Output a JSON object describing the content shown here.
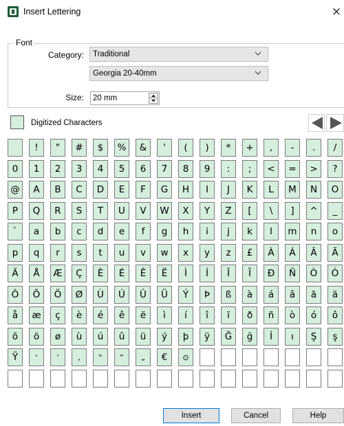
{
  "window": {
    "title": "Insert Lettering",
    "close_glyph": "×"
  },
  "font_group": {
    "legend": "Font",
    "category_label": "Category:",
    "category_value": "Traditional",
    "font_value": "Georgia 20-40mm",
    "size_label": "Size:",
    "size_value": "20 mm"
  },
  "digitized": {
    "label": "Digitized Characters",
    "checked": false
  },
  "character_grid": {
    "columns": 16,
    "rows": [
      [
        "",
        "!",
        "\"",
        "#",
        "$",
        "%",
        "&",
        "'",
        "(",
        ")",
        "*",
        "+",
        ",",
        "-",
        ".",
        "/"
      ],
      [
        "0",
        "1",
        "2",
        "3",
        "4",
        "5",
        "6",
        "7",
        "8",
        "9",
        ":",
        ";",
        "<",
        "=",
        ">",
        "?"
      ],
      [
        "@",
        "A",
        "B",
        "C",
        "D",
        "E",
        "F",
        "G",
        "H",
        "I",
        "J",
        "K",
        "L",
        "M",
        "N",
        "O"
      ],
      [
        "P",
        "Q",
        "R",
        "S",
        "T",
        "U",
        "V",
        "W",
        "X",
        "Y",
        "Z",
        "[",
        "\\",
        "]",
        "^",
        "_"
      ],
      [
        "`",
        "a",
        "b",
        "c",
        "d",
        "e",
        "f",
        "g",
        "h",
        "i",
        "j",
        "k",
        "l",
        "m",
        "n",
        "o"
      ],
      [
        "p",
        "q",
        "r",
        "s",
        "t",
        "u",
        "v",
        "w",
        "x",
        "y",
        "z",
        "£",
        "À",
        "Á",
        "Â",
        "Ã"
      ],
      [
        "Ä",
        "Å",
        "Æ",
        "Ç",
        "È",
        "É",
        "Ê",
        "Ë",
        "Ì",
        "Í",
        "Î",
        "Ï",
        "Đ",
        "Ñ",
        "Ò",
        "Ó"
      ],
      [
        "Ô",
        "Õ",
        "Ö",
        "Ø",
        "Ù",
        "Ú",
        "Û",
        "Ü",
        "Ý",
        "Þ",
        "ß",
        "à",
        "á",
        "â",
        "ã",
        "ä"
      ],
      [
        "å",
        "æ",
        "ç",
        "è",
        "é",
        "ê",
        "ë",
        "ì",
        "í",
        "î",
        "ï",
        "ð",
        "ñ",
        "ò",
        "ó",
        "ô"
      ],
      [
        "õ",
        "ö",
        "ø",
        "ù",
        "ú",
        "û",
        "ü",
        "ý",
        "þ",
        "ÿ",
        "Ğ",
        "ğ",
        "İ",
        "ı",
        "Ş",
        "ş"
      ],
      [
        "Ÿ",
        "‘",
        "’",
        "‚",
        "“",
        "”",
        "„",
        "€",
        "⊙",
        null,
        null,
        null,
        null,
        null,
        null,
        null
      ],
      [
        null,
        null,
        null,
        null,
        null,
        null,
        null,
        null,
        null,
        null,
        null,
        null,
        null,
        null,
        null,
        null
      ]
    ]
  },
  "buttons": {
    "insert": "Insert",
    "cancel": "Cancel",
    "help": "Help"
  },
  "colors": {
    "cell_fill": "#d5eedd",
    "cell_border": "#7a7a7a",
    "default_button_border": "#0078d7"
  }
}
